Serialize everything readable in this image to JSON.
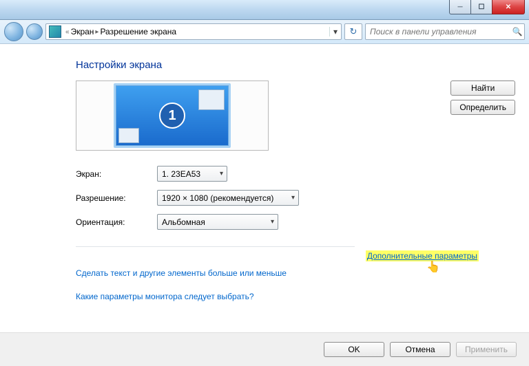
{
  "breadcrumb": {
    "root": "Экран",
    "current": "Разрешение экрана"
  },
  "search": {
    "placeholder": "Поиск в панели управления"
  },
  "title": "Настройки экрана",
  "monitor_number": "1",
  "buttons": {
    "find": "Найти",
    "identify": "Определить"
  },
  "labels": {
    "display": "Экран:",
    "resolution": "Разрешение:",
    "orientation": "Ориентация:"
  },
  "values": {
    "display": "1. 23EA53",
    "resolution": "1920 × 1080 (рекомендуется)",
    "orientation": "Альбомная"
  },
  "links": {
    "advanced": "Дополнительные параметры",
    "text_size": "Сделать текст и другие элементы больше или меньше",
    "which_monitor": "Какие параметры монитора следует выбрать?"
  },
  "footer": {
    "ok": "OK",
    "cancel": "Отмена",
    "apply": "Применить"
  }
}
